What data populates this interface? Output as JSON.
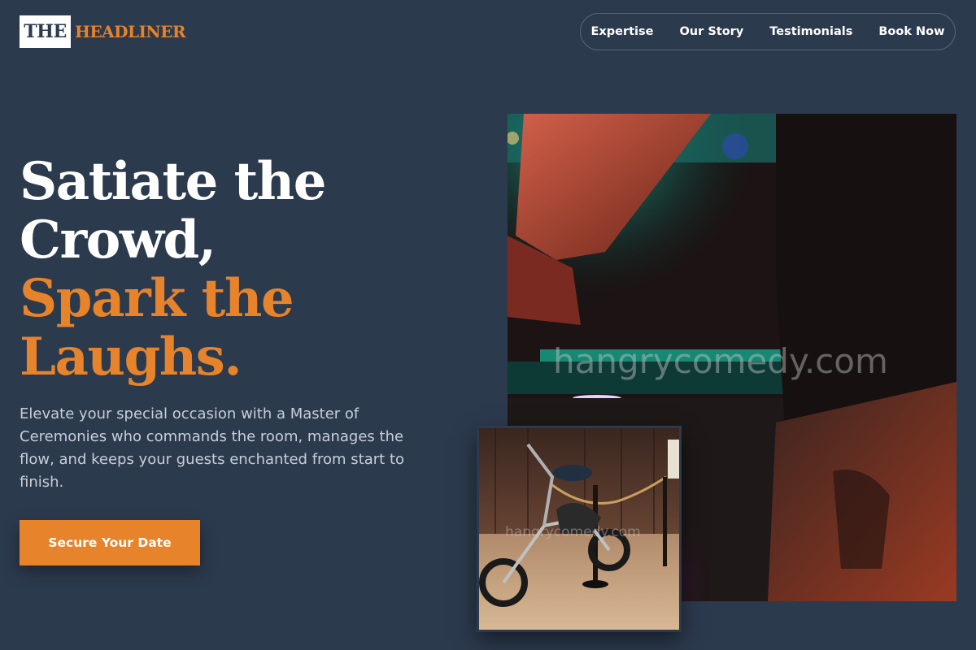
{
  "brand": {
    "part1": "THE",
    "part2": "HEADLINER"
  },
  "nav": {
    "items": [
      {
        "label": "Expertise"
      },
      {
        "label": "Our Story"
      },
      {
        "label": "Testimonials"
      },
      {
        "label": "Book Now"
      }
    ]
  },
  "hero": {
    "line1": "Satiate the",
    "line2": "Crowd,",
    "line3": "Spark the",
    "line4": "Laughs.",
    "description": "Elevate your special occasion with a Master of Ceremonies who commands the room, manages the flow, and keeps your guests enchanted from start to finish.",
    "cta_label": "Secure Your Date"
  },
  "images": {
    "main_watermark": "hangrycomedy.com",
    "small_watermark": "hangrycomedy.com"
  },
  "colors": {
    "background": "#2c3a4e",
    "accent": "#e7832a",
    "text": "#ffffff",
    "muted_text": "#c8ced8"
  }
}
